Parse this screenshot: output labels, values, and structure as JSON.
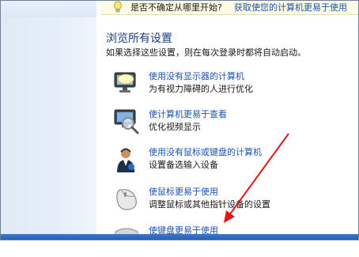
{
  "tip": {
    "question": "是否不确定从哪里开始?",
    "link": "获取使您的计算机更易于使用"
  },
  "section": {
    "title": "浏览所有设置",
    "description": "如果选择这些设置，则在每次登录时都将自动启动。"
  },
  "items": [
    {
      "title": "使用没有显示器的计算机",
      "desc": "为有视力障碍的人进行优化",
      "icon": "monitor-speech-icon"
    },
    {
      "title": "使计算机更易于查看",
      "desc": "优化视频显示",
      "icon": "magnifier-monitor-icon"
    },
    {
      "title": "使用没有鼠标或键盘的计算机",
      "desc": "设置备选输入设备",
      "icon": "person-headset-icon"
    },
    {
      "title": "使鼠标更易于使用",
      "desc": "调整鼠标或其他指针设备的设置",
      "icon": "mouse-icon"
    },
    {
      "title": "使键盘更易于使用",
      "desc": "",
      "icon": "keyboard-icon"
    }
  ],
  "colors": {
    "link": "#1e53b0",
    "heading": "#1e3f7a",
    "arrow": "#e01818"
  }
}
